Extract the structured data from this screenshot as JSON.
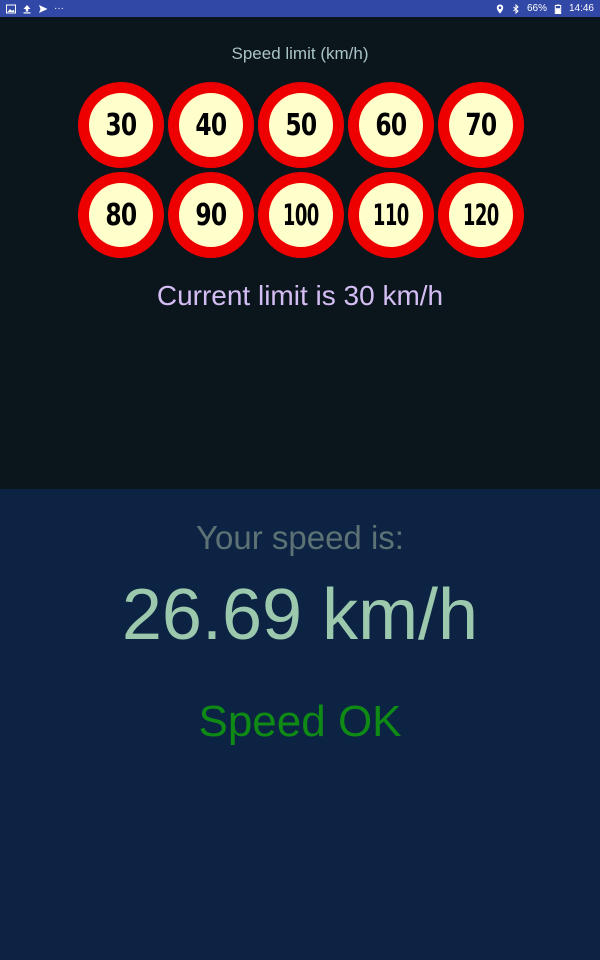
{
  "status_bar": {
    "left_icons": [
      "image-icon",
      "upload-icon",
      "send-icon",
      "more-icon"
    ],
    "more_label": "···",
    "right_icons": [
      "location-icon",
      "bluetooth-icon",
      "battery-icon"
    ],
    "battery_text": "66%",
    "time": "14:46",
    "background_color": "#3148a6"
  },
  "speed_limit": {
    "title": "Speed limit (km/h)",
    "signs": [
      "30",
      "40",
      "50",
      "60",
      "70",
      "80",
      "90",
      "100",
      "110",
      "120"
    ],
    "current_text": "Current limit is 30 km/h",
    "sign_ring_color": "#ee0000",
    "sign_fill_color": "#ffffcc"
  },
  "speed": {
    "caption": "Your speed is:",
    "value": "26.69 km/h",
    "status": "Speed OK",
    "status_color": "#0f8a15"
  }
}
